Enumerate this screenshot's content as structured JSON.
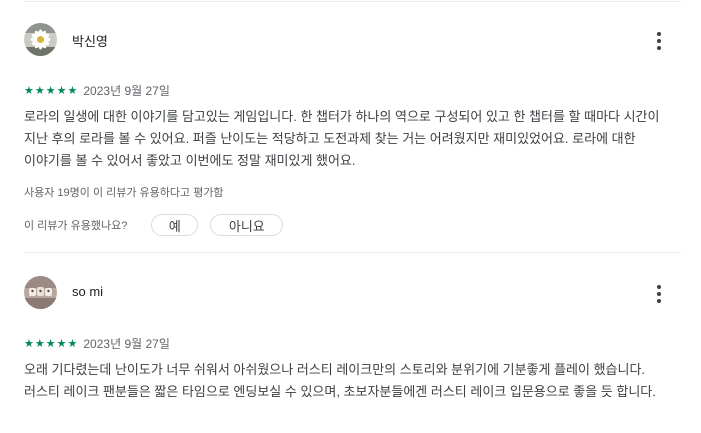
{
  "reviews": [
    {
      "author": "박신영",
      "avatar_icon": "daisy-flower-avatar",
      "rating": 5,
      "stars": [
        "★",
        "★",
        "★",
        "★",
        "★"
      ],
      "date": "2023년 9월 27일",
      "body": "로라의 일생에 대한 이야기를 담고있는 게임입니다. 한 챕터가 하나의 역으로 구성되어 있고 한 챕터를 할 때마다 시간이 지난 후의 로라를 볼 수 있어요. 퍼즐 난이도는 적당하고 도전과제 찾는 거는 어려웠지만 재미있었어요. 로라에 대한 이야기를 볼 수 있어서 좋았고 이번에도 정말 재미있게 했어요.",
      "helpful_count": "사용자 19명이 이 리뷰가 유용하다고 평가함",
      "helpful_question": "이 리뷰가 유용했나요?",
      "yes_label": "예",
      "no_label": "아니요"
    },
    {
      "author": "so mi",
      "avatar_icon": "photo-avatar",
      "rating": 5,
      "stars": [
        "★",
        "★",
        "★",
        "★",
        "★"
      ],
      "date": "2023년 9월 27일",
      "body": "오래 기다렸는데 난이도가 너무 쉬워서 아쉬웠으나 러스티 레이크만의 스토리와 분위기에 기분좋게 플레이 했습니다. 러스티 레이크 팬분들은 짧은 타임으로 엔딩보실 수 있으며, 초보자분들에겐 러스티 레이크 입문용으로 좋을 듯 합니다."
    }
  ],
  "colors": {
    "star": "#01875f",
    "text": "#3c4043",
    "muted": "#5f6368",
    "divider": "#e8eaed"
  }
}
